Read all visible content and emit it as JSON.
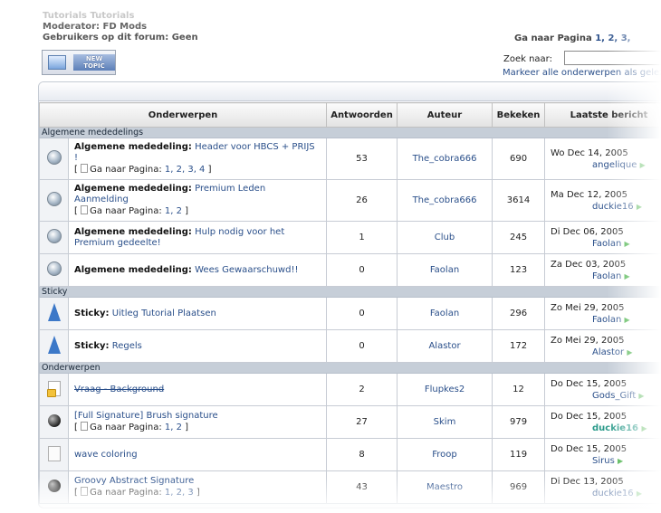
{
  "header": {
    "breadcrumb": "Tutorials Tutorials",
    "moderator_label": "Moderator:",
    "moderator_value": "FD Mods",
    "users_label": "Gebruikers op dit forum:",
    "users_value": "Geen",
    "goto_label": "Ga naar Pagina",
    "goto_pages": [
      "1,",
      "2,",
      "3,"
    ]
  },
  "new_topic": {
    "label_line1": "NEW",
    "label_line2": "TOPIC"
  },
  "search": {
    "label": "Zoek naar:",
    "value": ""
  },
  "mark_all_label": "Markeer alle onderwerpen als gelezen",
  "columns": [
    "Onderwerpen",
    "Antwoorden",
    "Auteur",
    "Bekeken",
    "Laatste bericht"
  ],
  "sections": {
    "announcements": "Algemene mededelings",
    "sticky": "Sticky",
    "topics": "Onderwerpen"
  },
  "goto_prefix": "Ga naar Pagina:",
  "rows": [
    {
      "prefix": "Algemene mededeling:",
      "title": "Header voor HBCS + PRIJS !",
      "pages": "1, 2, 3, 4",
      "replies": "53",
      "author": "The_cobra666",
      "views": "690",
      "date": "Wo Dec 14, 2005",
      "last_user": "angelique"
    },
    {
      "prefix": "Algemene mededeling:",
      "title": "Premium Leden Aanmelding",
      "pages": "1, 2",
      "replies": "26",
      "author": "The_cobra666",
      "views": "3614",
      "date": "Ma Dec 12, 2005",
      "last_user": "duckie16"
    },
    {
      "prefix": "Algemene mededeling:",
      "title": "Hulp nodig voor het Premium gedeelte!",
      "replies": "1",
      "author": "Club",
      "views": "245",
      "date": "Di Dec 06, 2005",
      "last_user": "Faolan"
    },
    {
      "prefix": "Algemene mededeling:",
      "title": "Wees Gewaarschuwd!!",
      "replies": "0",
      "author": "Faolan",
      "views": "123",
      "date": "Za Dec 03, 2005",
      "last_user": "Faolan"
    },
    {
      "prefix": "Sticky:",
      "title": "Uitleg Tutorial Plaatsen",
      "replies": "0",
      "author": "Faolan",
      "views": "296",
      "date": "Zo Mei 29, 2005",
      "last_user": "Faolan"
    },
    {
      "prefix": "Sticky:",
      "title": "Regels",
      "replies": "0",
      "author": "Alastor",
      "views": "172",
      "date": "Zo Mei 29, 2005",
      "last_user": "Alastor"
    },
    {
      "title": "Vraag - Background",
      "replies": "2",
      "author": "Flupkes2",
      "views": "12",
      "date": "Do Dec 15, 2005",
      "last_user": "Gods_Gift"
    },
    {
      "title": "[Full Signature] Brush signature",
      "pages": "1, 2",
      "replies": "27",
      "author": "Skim",
      "views": "979",
      "date": "Do Dec 15, 2005",
      "last_user": "duckie16"
    },
    {
      "title": "wave coloring",
      "replies": "8",
      "author": "Froop",
      "views": "119",
      "date": "Do Dec 15, 2005",
      "last_user": "Sirus"
    },
    {
      "title": "Groovy Abstract Signature",
      "pages": "1, 2, 3",
      "replies": "43",
      "author": "Maestro",
      "views": "969",
      "date": "Di Dec 13, 2005",
      "last_user": "duckie16"
    }
  ]
}
